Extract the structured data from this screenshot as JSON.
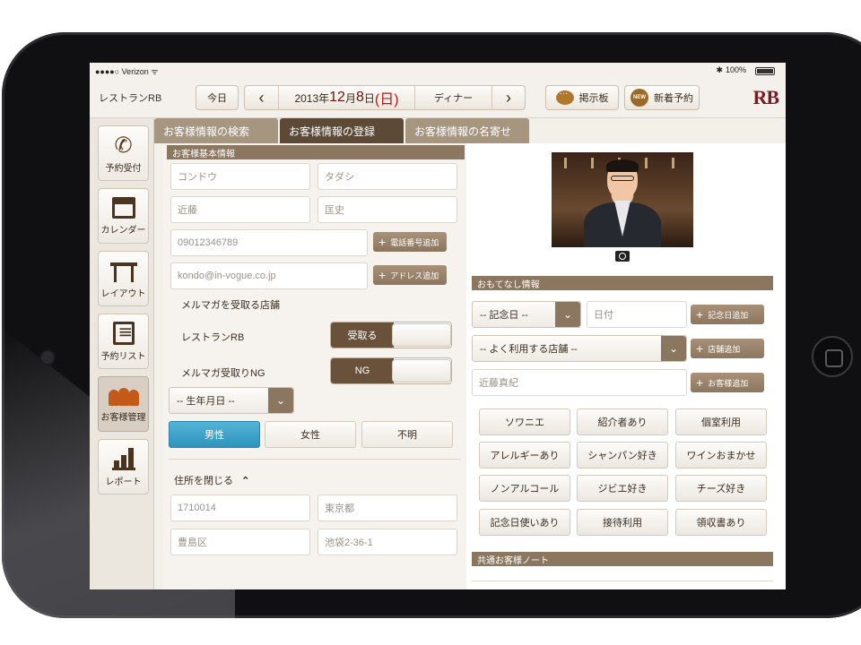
{
  "status": {
    "carrier": "●●●●○ Verizon ᯤ",
    "battery": "100%",
    "bluetooth": "✱"
  },
  "topbar": {
    "app_title": "レストランRB",
    "today": "今日",
    "prev": "‹",
    "next": "›",
    "date_prefix": "2013年",
    "month": "12",
    "month_suffix": "月",
    "day": "8",
    "day_suffix": "日",
    "weekday": "(日)",
    "meal": "ディナー",
    "board": "掲示板",
    "new_reservation": "新着予約",
    "new_badge": "NEW",
    "logo": "RB"
  },
  "sidebar": {
    "items": [
      {
        "label": "予約受付",
        "icon": "phone-icon"
      },
      {
        "label": "カレンダー",
        "icon": "calendar-icon"
      },
      {
        "label": "レイアウト",
        "icon": "table-layout-icon"
      },
      {
        "label": "予約リスト",
        "icon": "list-icon"
      },
      {
        "label": "お客様管理",
        "icon": "customers-icon"
      },
      {
        "label": "レポート",
        "icon": "report-icon"
      }
    ],
    "active_index": 4
  },
  "tabs": [
    {
      "label": "お客様情報の検索"
    },
    {
      "label": "お客様情報の登録"
    },
    {
      "label": "お客様情報の名寄せ"
    }
  ],
  "basic": {
    "header": "お客様基本情報",
    "kana_last": "コンドウ",
    "kana_first": "タダシ",
    "last": "近藤",
    "first": "匡史",
    "phone": "09012346789",
    "add_phone": "電話番号追加",
    "email": "kondo@in-vogue.co.jp",
    "add_address": "アドレス追加",
    "newsletter_label": "メルマガを受取る店舗",
    "store_label": "レストランRB",
    "store_toggle": "受取る",
    "ng_label": "メルマガ受取りNG",
    "ng_toggle": "NG",
    "birthday": "-- 生年月日 --",
    "gender": [
      "男性",
      "女性",
      "不明"
    ],
    "address_toggle": "住所を閉じる",
    "postal": "1710014",
    "prefecture": "東京都",
    "city": "豊島区",
    "street": "池袋2-36-1"
  },
  "hospitality": {
    "header": "おもてなし情報",
    "anniversary": "-- 記念日 --",
    "date_placeholder": "日付",
    "add_anniversary": "記念日追加",
    "store": "-- よく利用する店舗 --",
    "add_store": "店舗追加",
    "customer": "近藤真紀",
    "add_customer": "お客様追加",
    "tags": [
      "ソワニエ",
      "紹介者あり",
      "個室利用",
      "アレルギーあり",
      "シャンパン好き",
      "ワインおまかせ",
      "ノンアルコール",
      "ジビエ好き",
      "チーズ好き",
      "記念日使いあり",
      "接待利用",
      "領収書あり"
    ],
    "notes_header": "共通お客様ノート"
  }
}
